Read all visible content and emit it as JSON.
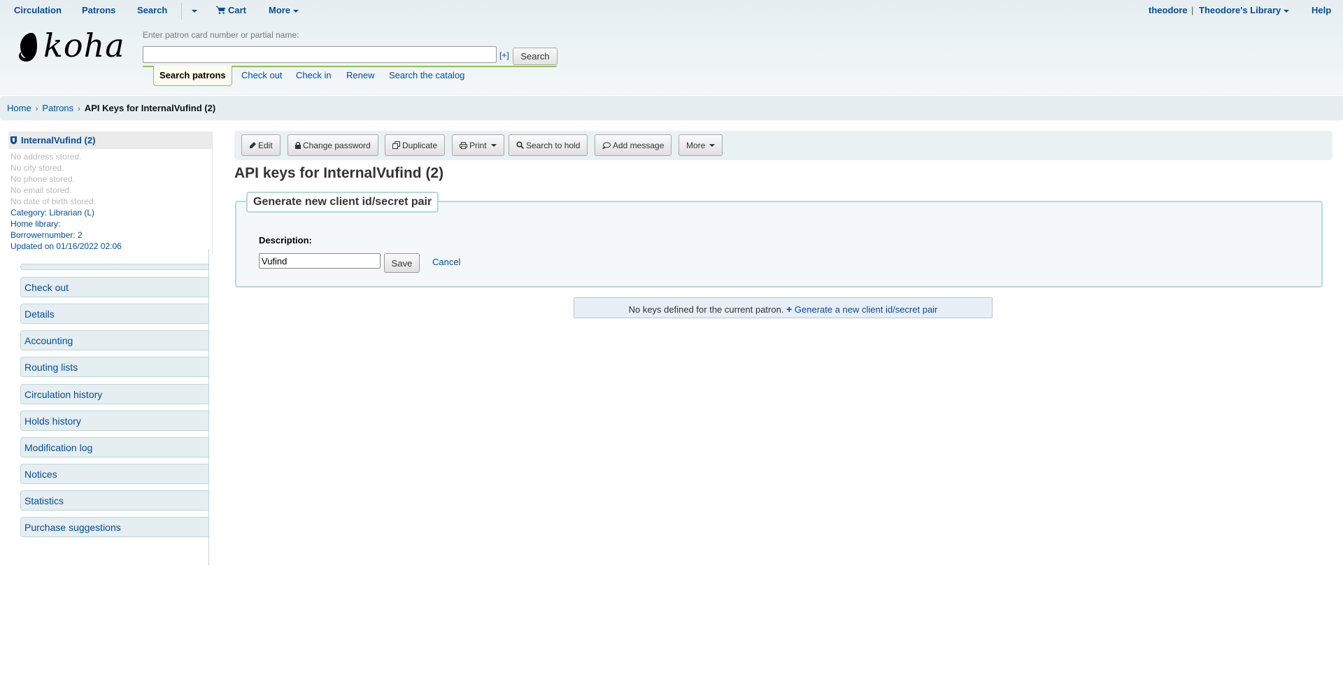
{
  "topnav": {
    "left": [
      {
        "label": "Circulation"
      },
      {
        "label": "Patrons"
      },
      {
        "label": "Search"
      },
      {
        "label": "Cart",
        "icon": "cart-icon"
      },
      {
        "label": "More",
        "dropdown": true
      }
    ],
    "user": "theodore",
    "separator": "|",
    "library": "Theodore's Library",
    "help": "Help"
  },
  "header": {
    "logo_text": "koha",
    "search_label": "Enter patron card number or partial name:",
    "search_value": "",
    "search_placeholder": "",
    "advanced_toggle": "[+]",
    "search_button": "Search",
    "resident_tabs": [
      {
        "label": "Search patrons",
        "active": true
      },
      {
        "label": "Check out"
      },
      {
        "label": "Check in"
      },
      {
        "label": "Renew"
      },
      {
        "label": "Search the catalog"
      }
    ]
  },
  "breadcrumb": {
    "items": [
      "Home",
      "Patrons"
    ],
    "current": "API Keys for InternalVufind (2)",
    "separator": "›"
  },
  "patron": {
    "name": "InternalVufind (2)",
    "empty_lines": [
      "No address stored.",
      "No city stored.",
      "No phone stored.",
      "No email stored.",
      "No date of birth stored."
    ],
    "info_lines": [
      "Category: Librarian (L)",
      "Home library:",
      "Borrowernumber: 2",
      "Updated on 01/16/2022 02:06"
    ]
  },
  "sidenav": {
    "items": [
      {
        "label": "Check out"
      },
      {
        "label": "Details"
      },
      {
        "label": "Accounting"
      },
      {
        "label": "Routing lists"
      },
      {
        "label": "Circulation history"
      },
      {
        "label": "Holds history"
      },
      {
        "label": "Modification log"
      },
      {
        "label": "Notices"
      },
      {
        "label": "Statistics"
      },
      {
        "label": "Purchase suggestions"
      }
    ]
  },
  "toolbar": {
    "buttons": [
      {
        "label": "Edit",
        "icon": "pencil-icon"
      },
      {
        "label": "Change password",
        "icon": "lock-icon"
      },
      {
        "label": "Duplicate",
        "icon": "copy-icon"
      },
      {
        "label": "Print",
        "icon": "print-icon",
        "dropdown": true
      },
      {
        "label": "Search to hold",
        "icon": "search-icon"
      },
      {
        "label": "Add message",
        "icon": "comment-icon"
      },
      {
        "label": "More",
        "dropdown": true
      }
    ]
  },
  "main": {
    "title": "API keys for InternalVufind (2)",
    "form": {
      "legend": "Generate new client id/secret pair",
      "description_label": "Description:",
      "description_value": "Vufind",
      "save_label": "Save",
      "cancel_label": "Cancel"
    },
    "empty_message": "No keys defined for the current patron.",
    "generate_link": "Generate a new client id/secret pair"
  },
  "colors": {
    "link": "#004d99",
    "header_bg": "#e6eef2",
    "border_accent": "#b9d8d9",
    "tab_accent": "#8cc44f"
  }
}
